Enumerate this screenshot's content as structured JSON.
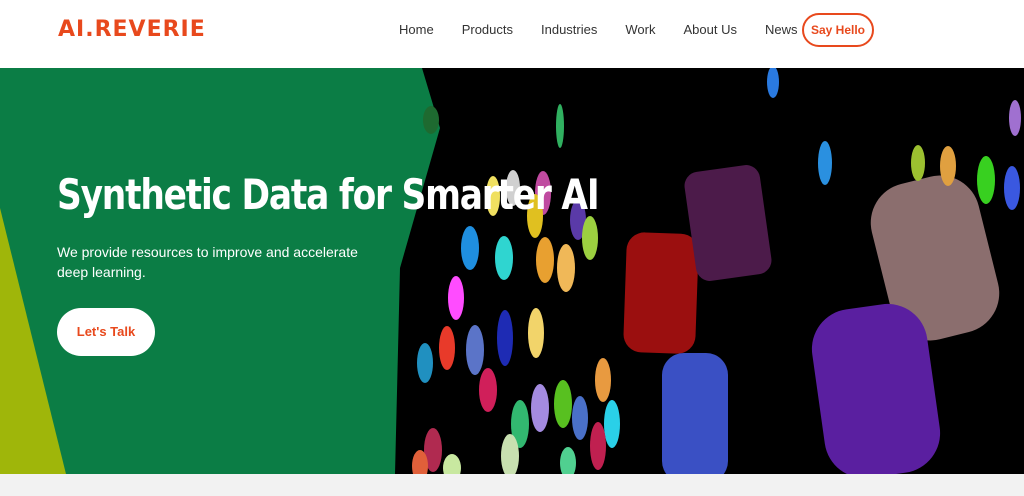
{
  "brand": {
    "logo_text": "AI.REVERIE",
    "accent": "#e8491d"
  },
  "nav": {
    "items": [
      "Home",
      "Products",
      "Industries",
      "Work",
      "About Us",
      "News"
    ],
    "cta": "Say Hello"
  },
  "hero": {
    "title": "Synthetic Data for Smarter AI",
    "subtitle": "We provide resources to improve and accelerate deep learning.",
    "cta": "Let's Talk",
    "panel_color": "#0b7d45",
    "stripe_color": "#9fb60a"
  }
}
